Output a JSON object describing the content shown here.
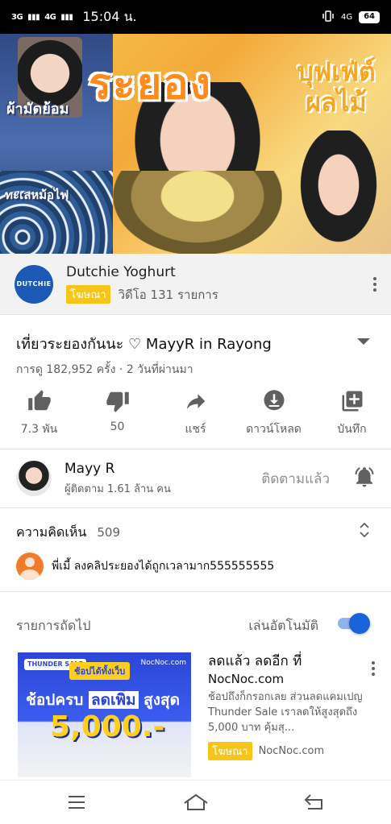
{
  "status_bar": {
    "signal_left": "3G",
    "signal_right": "4G",
    "time": "15:04 น.",
    "network": "4G",
    "battery": "64"
  },
  "video": {
    "overlay_big": "ระยอง",
    "overlay_right": "บุฟเฟ่ต์ผลไม้",
    "overlay_left_top": "ผ้ามัดย้อม",
    "overlay_left_bottom": "ทะเลหม้อไฟ"
  },
  "ad_banner": {
    "logo_text": "DUTCHIE",
    "title": "Dutchie Yoghurt",
    "badge": "โฆษณา",
    "meta": "วิดีโอ 131 รายการ"
  },
  "video_info": {
    "title": "เที่ยวระยองกันนะ ♡ MayyR in Rayong",
    "stats": "การดู 182,952 ครั้ง · 2 วันที่ผ่านมา",
    "actions": [
      {
        "label": "7.3 พัน",
        "icon": "thumbs-up-icon"
      },
      {
        "label": "50",
        "icon": "thumbs-down-icon"
      },
      {
        "label": "แชร์",
        "icon": "share-icon"
      },
      {
        "label": "ดาวน์โหลด",
        "icon": "download-icon"
      },
      {
        "label": "บันทึก",
        "icon": "add-to-playlist-icon"
      }
    ]
  },
  "channel": {
    "name": "Mayy R",
    "subscribers": "ผู้ติดตาม 1.61 ล้าน คน",
    "subscribed_label": "ติดตามแล้ว"
  },
  "comments": {
    "title": "ความคิดเห็น",
    "count": "509",
    "top_comment": "พี่เมี้ ลงคลิประยองได้ถูกเวลามาก555555555"
  },
  "up_next": {
    "title": "รายการถัดไป",
    "autoplay_label": "เล่นอัตโนมัติ",
    "autoplay_on": true
  },
  "ad_card": {
    "thumb_badge": "THUNDER SALE",
    "thumb_flag": "ช้อปได้ทั้งเว็บ",
    "thumb_brand": "NocNoc.com",
    "thumb_line1_prefix": "ช้อปครบ",
    "thumb_line1_highlight": "ลดเพิ่ม",
    "thumb_line1_suffix": "สูงสุด",
    "thumb_price": "5,000.-",
    "headline": "ลดแล้ว ลดอีก ที่",
    "advertiser": "NocNoc.com",
    "description": "ช้อปถึงก็กรอกเลย ส่วนลดแคมเปญ Thunder Sale เราลดให้สูงสุดถึง 5,000 บาท คุ้มสุ...",
    "badge": "โฆษณา",
    "domain": "NocNoc.com"
  },
  "colors": {
    "accent_blue": "#1a63d8",
    "ad_yellow": "#f5c518",
    "text_secondary": "#606060"
  }
}
